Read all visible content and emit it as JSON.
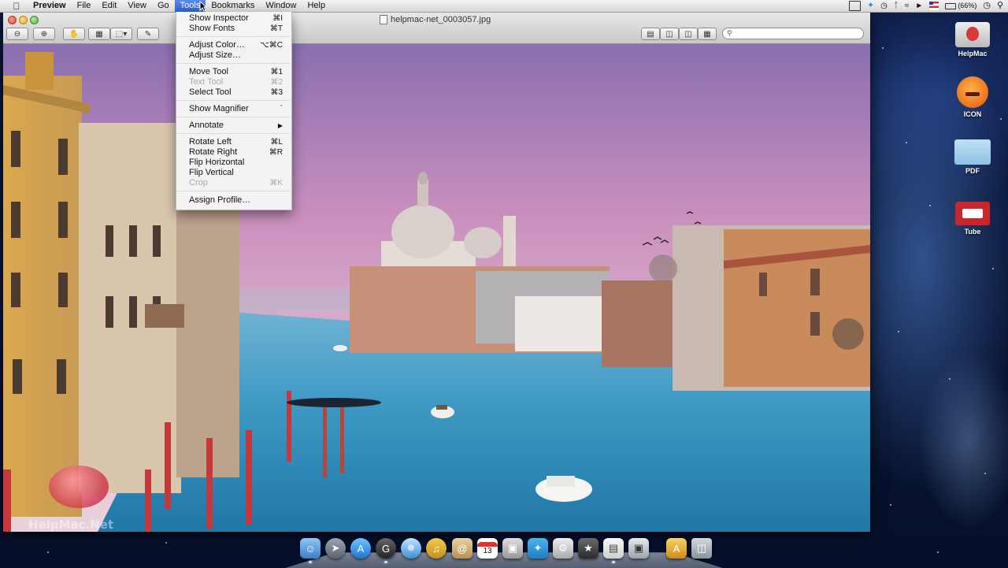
{
  "menubar": {
    "app_name": "Preview",
    "items": [
      "File",
      "Edit",
      "View",
      "Go",
      "Tools",
      "Bookmarks",
      "Window",
      "Help"
    ],
    "battery_text": "(66%)"
  },
  "window": {
    "title": "helpmac-net_0003057.jpg",
    "search_placeholder": ""
  },
  "tools_menu": {
    "items": [
      {
        "label": "Show Inspector",
        "shortcut": "⌘I"
      },
      {
        "label": "Show Fonts",
        "shortcut": "⌘T"
      },
      {
        "label": "Adjust Color…",
        "shortcut": "⌥⌘C"
      },
      {
        "label": "Adjust Size…",
        "shortcut": ""
      },
      {
        "label": "Move Tool",
        "shortcut": "⌘1"
      },
      {
        "label": "Text Tool",
        "shortcut": "⌘2"
      },
      {
        "label": "Select Tool",
        "shortcut": "⌘3"
      },
      {
        "label": "Show Magnifier",
        "shortcut": "`"
      },
      {
        "label": "Annotate",
        "shortcut": "▶"
      },
      {
        "label": "Rotate Left",
        "shortcut": "⌘L"
      },
      {
        "label": "Rotate Right",
        "shortcut": "⌘R"
      },
      {
        "label": "Flip Horizontal",
        "shortcut": ""
      },
      {
        "label": "Flip Vertical",
        "shortcut": ""
      },
      {
        "label": "Crop",
        "shortcut": "⌘K"
      },
      {
        "label": "Assign Profile…",
        "shortcut": ""
      }
    ]
  },
  "desktop_icons": [
    {
      "label": "HelpMac"
    },
    {
      "label": "ICON"
    },
    {
      "label": "PDF"
    },
    {
      "label": "Tube"
    }
  ],
  "dock": {
    "calendar_day": "13"
  },
  "watermark": {
    "text": "HelpMac.Net"
  },
  "colors": {
    "menu_highlight": "#2f62d4",
    "sky_top": "#8a6fb0",
    "water": "#3f9ac4"
  }
}
